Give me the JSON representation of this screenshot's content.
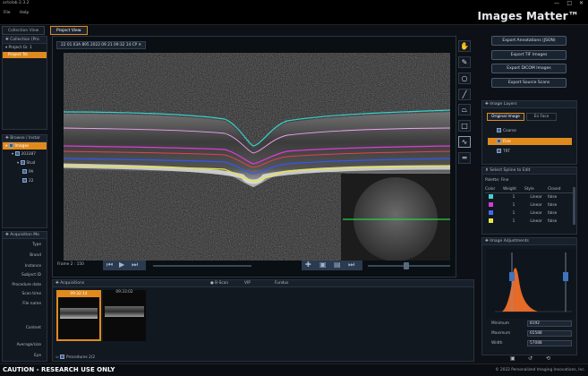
{
  "window": {
    "title": "octolab 2.3.2",
    "brand": "Images Matter™"
  },
  "menu": [
    "File",
    "Help"
  ],
  "tabs": [
    "Collection View",
    "Project View"
  ],
  "left": {
    "collection_header": "Collection (Pro",
    "collection_items": [
      "Project Gr. 1",
      "Project Tst"
    ],
    "browse_header": "Browse / Instar",
    "browse_items": [
      "Images",
      "203387",
      "Stud",
      "PA",
      "22"
    ],
    "acq_header": "Acquisition Mo",
    "acq_labels": [
      "Type",
      "Brand",
      "Instance",
      "Subject ID",
      "Procedure date",
      "Scan time",
      "File name",
      "Content",
      "Average/size",
      "Eye"
    ]
  },
  "viewer": {
    "tab_label": "22 01 03A  895 2022 09 21 09:32 14  CP",
    "frame_label": "Frame 2 : 150"
  },
  "bottom": {
    "acq_header": "Acquisitions",
    "radios": [
      "B-Scan",
      "VIP",
      "Fundus"
    ],
    "thumbs": [
      "09:32:14",
      "09:33:02"
    ],
    "procedures": "Procedures 2/2"
  },
  "right": {
    "buttons": [
      "Export Annotations (JSON)",
      "Export TIF Images",
      "Export DICOM Images",
      "Export Source Scans"
    ],
    "layers_header": "Image Layers",
    "layer_tabs": [
      "Original Image",
      "En Face"
    ],
    "layers": [
      "Coarse",
      "Fine",
      "TRT"
    ],
    "spline_header": "Select Spline to Edit",
    "palette_label": "Palette: Fine",
    "table_headers": [
      "Color",
      "Weight",
      "Style",
      "Closed"
    ],
    "table_rows": [
      {
        "color": "#4bd0c8",
        "weight": "1",
        "style": "Linear",
        "closed": "false"
      },
      {
        "color": "#d63ad8",
        "weight": "1",
        "style": "Linear",
        "closed": "false"
      },
      {
        "color": "#3f6cf0",
        "weight": "1",
        "style": "Linear",
        "closed": "false"
      },
      {
        "color": "#e8e84a",
        "weight": "1",
        "style": "Linear",
        "closed": "false"
      }
    ],
    "adjust_header": "Image Adjustments",
    "min_label": "Minimum",
    "min_value": "8192",
    "max_label": "Maximum",
    "max_value": "65588",
    "width_label": "Width",
    "width_value": "57088"
  },
  "status": {
    "caution": "CAUTION - RESEARCH USE ONLY",
    "copyright": "© 2022 Personalized Imaging Innovations, Inc."
  },
  "colors": {
    "accent": "#e08a1d",
    "cyan": "#34d2d0",
    "magenta": "#e03ad8",
    "blue": "#3158f0",
    "yellow": "#e8e640",
    "green": "#28d040"
  }
}
